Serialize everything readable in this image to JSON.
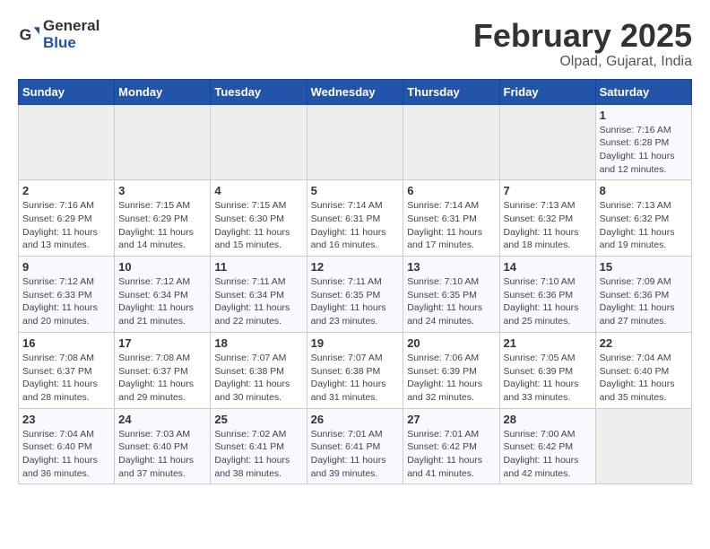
{
  "logo": {
    "general": "General",
    "blue": "Blue"
  },
  "title": "February 2025",
  "subtitle": "Olpad, Gujarat, India",
  "headers": [
    "Sunday",
    "Monday",
    "Tuesday",
    "Wednesday",
    "Thursday",
    "Friday",
    "Saturday"
  ],
  "weeks": [
    [
      {
        "day": "",
        "info": ""
      },
      {
        "day": "",
        "info": ""
      },
      {
        "day": "",
        "info": ""
      },
      {
        "day": "",
        "info": ""
      },
      {
        "day": "",
        "info": ""
      },
      {
        "day": "",
        "info": ""
      },
      {
        "day": "1",
        "info": "Sunrise: 7:16 AM\nSunset: 6:28 PM\nDaylight: 11 hours and 12 minutes."
      }
    ],
    [
      {
        "day": "2",
        "info": "Sunrise: 7:16 AM\nSunset: 6:29 PM\nDaylight: 11 hours and 13 minutes."
      },
      {
        "day": "3",
        "info": "Sunrise: 7:15 AM\nSunset: 6:29 PM\nDaylight: 11 hours and 14 minutes."
      },
      {
        "day": "4",
        "info": "Sunrise: 7:15 AM\nSunset: 6:30 PM\nDaylight: 11 hours and 15 minutes."
      },
      {
        "day": "5",
        "info": "Sunrise: 7:14 AM\nSunset: 6:31 PM\nDaylight: 11 hours and 16 minutes."
      },
      {
        "day": "6",
        "info": "Sunrise: 7:14 AM\nSunset: 6:31 PM\nDaylight: 11 hours and 17 minutes."
      },
      {
        "day": "7",
        "info": "Sunrise: 7:13 AM\nSunset: 6:32 PM\nDaylight: 11 hours and 18 minutes."
      },
      {
        "day": "8",
        "info": "Sunrise: 7:13 AM\nSunset: 6:32 PM\nDaylight: 11 hours and 19 minutes."
      }
    ],
    [
      {
        "day": "9",
        "info": "Sunrise: 7:12 AM\nSunset: 6:33 PM\nDaylight: 11 hours and 20 minutes."
      },
      {
        "day": "10",
        "info": "Sunrise: 7:12 AM\nSunset: 6:34 PM\nDaylight: 11 hours and 21 minutes."
      },
      {
        "day": "11",
        "info": "Sunrise: 7:11 AM\nSunset: 6:34 PM\nDaylight: 11 hours and 22 minutes."
      },
      {
        "day": "12",
        "info": "Sunrise: 7:11 AM\nSunset: 6:35 PM\nDaylight: 11 hours and 23 minutes."
      },
      {
        "day": "13",
        "info": "Sunrise: 7:10 AM\nSunset: 6:35 PM\nDaylight: 11 hours and 24 minutes."
      },
      {
        "day": "14",
        "info": "Sunrise: 7:10 AM\nSunset: 6:36 PM\nDaylight: 11 hours and 25 minutes."
      },
      {
        "day": "15",
        "info": "Sunrise: 7:09 AM\nSunset: 6:36 PM\nDaylight: 11 hours and 27 minutes."
      }
    ],
    [
      {
        "day": "16",
        "info": "Sunrise: 7:08 AM\nSunset: 6:37 PM\nDaylight: 11 hours and 28 minutes."
      },
      {
        "day": "17",
        "info": "Sunrise: 7:08 AM\nSunset: 6:37 PM\nDaylight: 11 hours and 29 minutes."
      },
      {
        "day": "18",
        "info": "Sunrise: 7:07 AM\nSunset: 6:38 PM\nDaylight: 11 hours and 30 minutes."
      },
      {
        "day": "19",
        "info": "Sunrise: 7:07 AM\nSunset: 6:38 PM\nDaylight: 11 hours and 31 minutes."
      },
      {
        "day": "20",
        "info": "Sunrise: 7:06 AM\nSunset: 6:39 PM\nDaylight: 11 hours and 32 minutes."
      },
      {
        "day": "21",
        "info": "Sunrise: 7:05 AM\nSunset: 6:39 PM\nDaylight: 11 hours and 33 minutes."
      },
      {
        "day": "22",
        "info": "Sunrise: 7:04 AM\nSunset: 6:40 PM\nDaylight: 11 hours and 35 minutes."
      }
    ],
    [
      {
        "day": "23",
        "info": "Sunrise: 7:04 AM\nSunset: 6:40 PM\nDaylight: 11 hours and 36 minutes."
      },
      {
        "day": "24",
        "info": "Sunrise: 7:03 AM\nSunset: 6:40 PM\nDaylight: 11 hours and 37 minutes."
      },
      {
        "day": "25",
        "info": "Sunrise: 7:02 AM\nSunset: 6:41 PM\nDaylight: 11 hours and 38 minutes."
      },
      {
        "day": "26",
        "info": "Sunrise: 7:01 AM\nSunset: 6:41 PM\nDaylight: 11 hours and 39 minutes."
      },
      {
        "day": "27",
        "info": "Sunrise: 7:01 AM\nSunset: 6:42 PM\nDaylight: 11 hours and 41 minutes."
      },
      {
        "day": "28",
        "info": "Sunrise: 7:00 AM\nSunset: 6:42 PM\nDaylight: 11 hours and 42 minutes."
      },
      {
        "day": "",
        "info": ""
      }
    ]
  ]
}
